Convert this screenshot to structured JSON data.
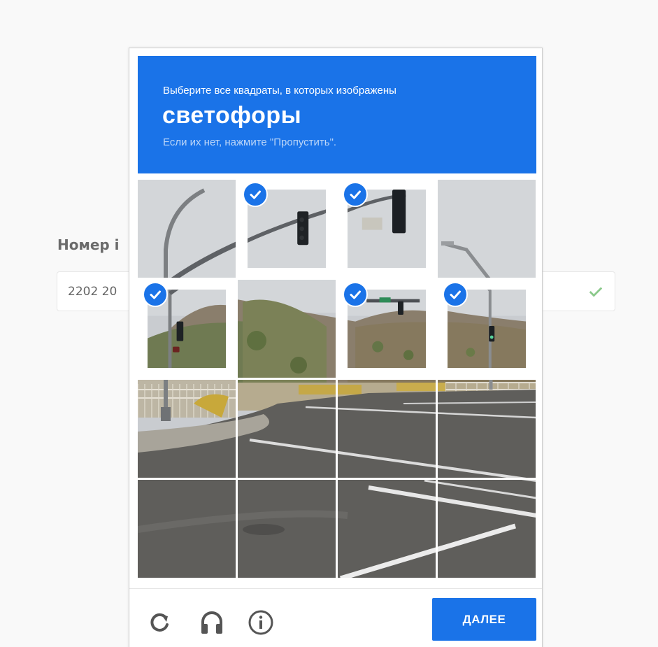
{
  "page": {
    "field_label": "Номер i",
    "field_value": "2202 20"
  },
  "captcha": {
    "instruction": "Выберите все квадраты, в которых изображены",
    "keyword": "светофоры",
    "hint": "Если их нет, нажмите \"Пропустить\".",
    "next_label": "ДАЛЕЕ",
    "icons": [
      "reload-icon",
      "audio-icon",
      "info-icon"
    ],
    "accent": "#1a73e8",
    "tiles": [
      {
        "selected": false
      },
      {
        "selected": true
      },
      {
        "selected": true
      },
      {
        "selected": false
      },
      {
        "selected": true
      },
      {
        "selected": false
      },
      {
        "selected": true
      },
      {
        "selected": true
      },
      {
        "selected": false
      },
      {
        "selected": false
      },
      {
        "selected": false
      },
      {
        "selected": false
      },
      {
        "selected": false
      },
      {
        "selected": false
      },
      {
        "selected": false
      },
      {
        "selected": false
      }
    ]
  }
}
